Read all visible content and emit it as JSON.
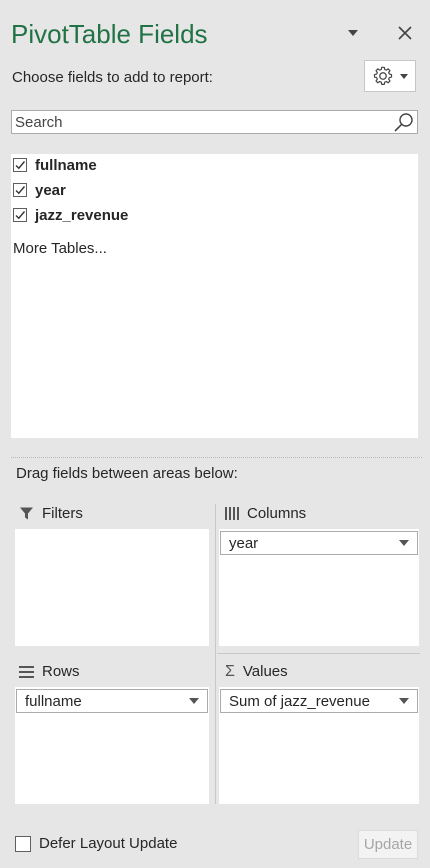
{
  "header": {
    "title": "PivotTable Fields",
    "subtitle": "Choose fields to add to report:"
  },
  "search": {
    "placeholder": "Search",
    "value": ""
  },
  "fields": [
    {
      "label": "fullname",
      "checked": true
    },
    {
      "label": "year",
      "checked": true
    },
    {
      "label": "jazz_revenue",
      "checked": true
    }
  ],
  "more_tables": "More Tables...",
  "drag_label": "Drag fields between areas below:",
  "areas": {
    "filters": {
      "label": "Filters",
      "items": []
    },
    "columns": {
      "label": "Columns",
      "items": [
        "year"
      ]
    },
    "rows": {
      "label": "Rows",
      "items": [
        "fullname"
      ]
    },
    "values": {
      "label": "Values",
      "items": [
        "Sum of jazz_revenue"
      ]
    }
  },
  "footer": {
    "defer_label": "Defer Layout Update",
    "update_label": "Update"
  },
  "colors": {
    "title": "#217346",
    "panel_bg": "#e6e6e6",
    "box_bg": "#ffffff"
  }
}
